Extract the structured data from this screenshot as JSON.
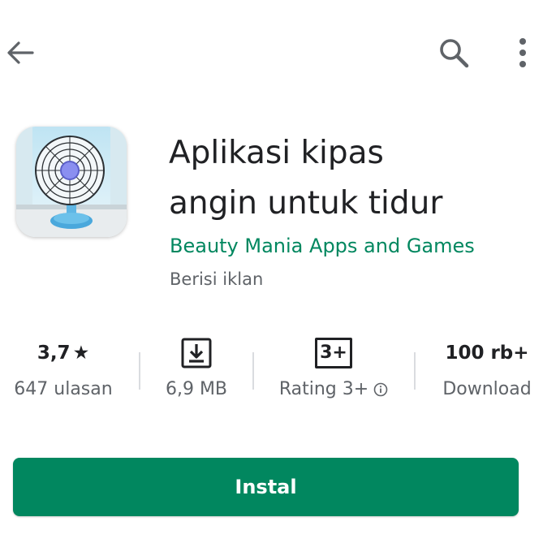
{
  "header": {
    "icons": [
      "back-arrow-icon",
      "search-icon",
      "more-vert-icon"
    ]
  },
  "app": {
    "title_line1": "Aplikasi kipas",
    "title_line2": "angin untuk tidur",
    "developer": "Beauty Mania Apps and Games",
    "ads_notice": "Berisi iklan",
    "icon": "fan-app-icon"
  },
  "stats": {
    "rating_value": "3,7",
    "rating_star": "★",
    "reviews": "647 ulasan",
    "size": "6,9 MB",
    "content_rating_badge": "3+",
    "content_rating_label": "Rating 3+",
    "downloads_value": "100 rb+",
    "downloads_label": "Download"
  },
  "install_button": {
    "label": "Instal"
  },
  "colors": {
    "accent_green": "#01875f",
    "text_primary": "#202124",
    "text_secondary": "#5f6368",
    "divider": "#dadce0"
  }
}
